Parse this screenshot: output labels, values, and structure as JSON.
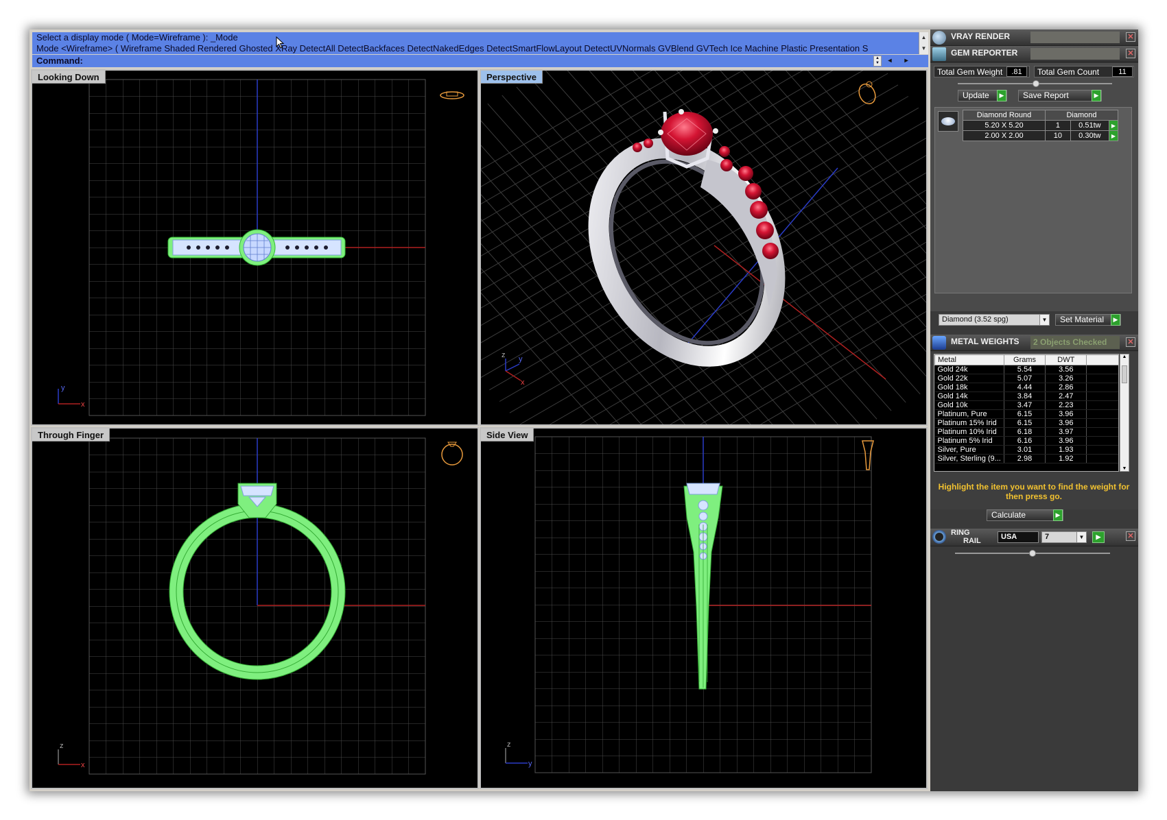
{
  "command": {
    "history_line1": "Select a display mode ( Mode=Wireframe ): _Mode",
    "history_line2": "Mode <Wireframe> ( Wireframe  Shaded  Rendered  Ghosted  XRay  DetectAll  DetectBackfaces  DetectNakedEdges  DetectSmartFlowLayout  DetectUVNormals  GVBlend  GVTech  Ice  Machine  Plastic  Presentation  S",
    "prompt_label": "Command:",
    "input_value": ""
  },
  "viewports": {
    "top_left": {
      "title": "Looking Down"
    },
    "top_right": {
      "title": "Perspective"
    },
    "bottom_left": {
      "title": "Through Finger"
    },
    "bottom_right": {
      "title": "Side View"
    },
    "axis_labels": {
      "x": "x",
      "y": "y",
      "z": "z"
    }
  },
  "panel": {
    "vray": {
      "title": "VRAY RENDER"
    },
    "gem": {
      "title": "GEM REPORTER",
      "total_weight_label": "Total Gem Weight",
      "total_weight_value": ".81",
      "total_count_label": "Total Gem Count",
      "total_count_value": "11",
      "update_label": "Update",
      "save_label": "Save Report",
      "table_headers": [
        "Diamond Round",
        "Diamond"
      ],
      "rows": [
        {
          "size": "5.20 X 5.20",
          "qty": "1",
          "weight": "0.51tw"
        },
        {
          "size": "2.00 X 2.00",
          "qty": "10",
          "weight": "0.30tw"
        }
      ],
      "material_select": "Diamond    (3.52 spg)",
      "set_material_label": "Set Material"
    },
    "metal": {
      "title": "METAL WEIGHTS",
      "status": "2 Objects Checked",
      "headers": [
        "Metal",
        "Grams",
        "DWT"
      ],
      "rows": [
        {
          "metal": "Gold 24k",
          "grams": "5.54",
          "dwt": "3.56"
        },
        {
          "metal": "Gold 22k",
          "grams": "5.07",
          "dwt": "3.26"
        },
        {
          "metal": "Gold 18k",
          "grams": "4.44",
          "dwt": "2.86"
        },
        {
          "metal": "Gold 14k",
          "grams": "3.84",
          "dwt": "2.47"
        },
        {
          "metal": "Gold 10k",
          "grams": "3.47",
          "dwt": "2.23"
        },
        {
          "metal": "Platinum, Pure",
          "grams": "6.15",
          "dwt": "3.96"
        },
        {
          "metal": "Platinum 15% Irid",
          "grams": "6.15",
          "dwt": "3.96"
        },
        {
          "metal": "Platinum 10% Irid",
          "grams": "6.18",
          "dwt": "3.97"
        },
        {
          "metal": "Platinum 5% Irid",
          "grams": "6.16",
          "dwt": "3.96"
        },
        {
          "metal": "Silver, Pure",
          "grams": "3.01",
          "dwt": "1.93"
        },
        {
          "metal": "Silver, Sterling (9...",
          "grams": "2.98",
          "dwt": "1.92"
        }
      ],
      "hint": "Highlight the item you want to find the weight for then press go.",
      "calculate_label": "Calculate"
    },
    "ring_rail": {
      "title_line1": "RING",
      "title_line2": "RAIL",
      "country": "USA",
      "size": "7"
    }
  },
  "colors": {
    "command_bg": "#5b82e5",
    "wire_green": "#66ee66",
    "ruby": "#c0102a",
    "go_green": "#2da12d"
  }
}
